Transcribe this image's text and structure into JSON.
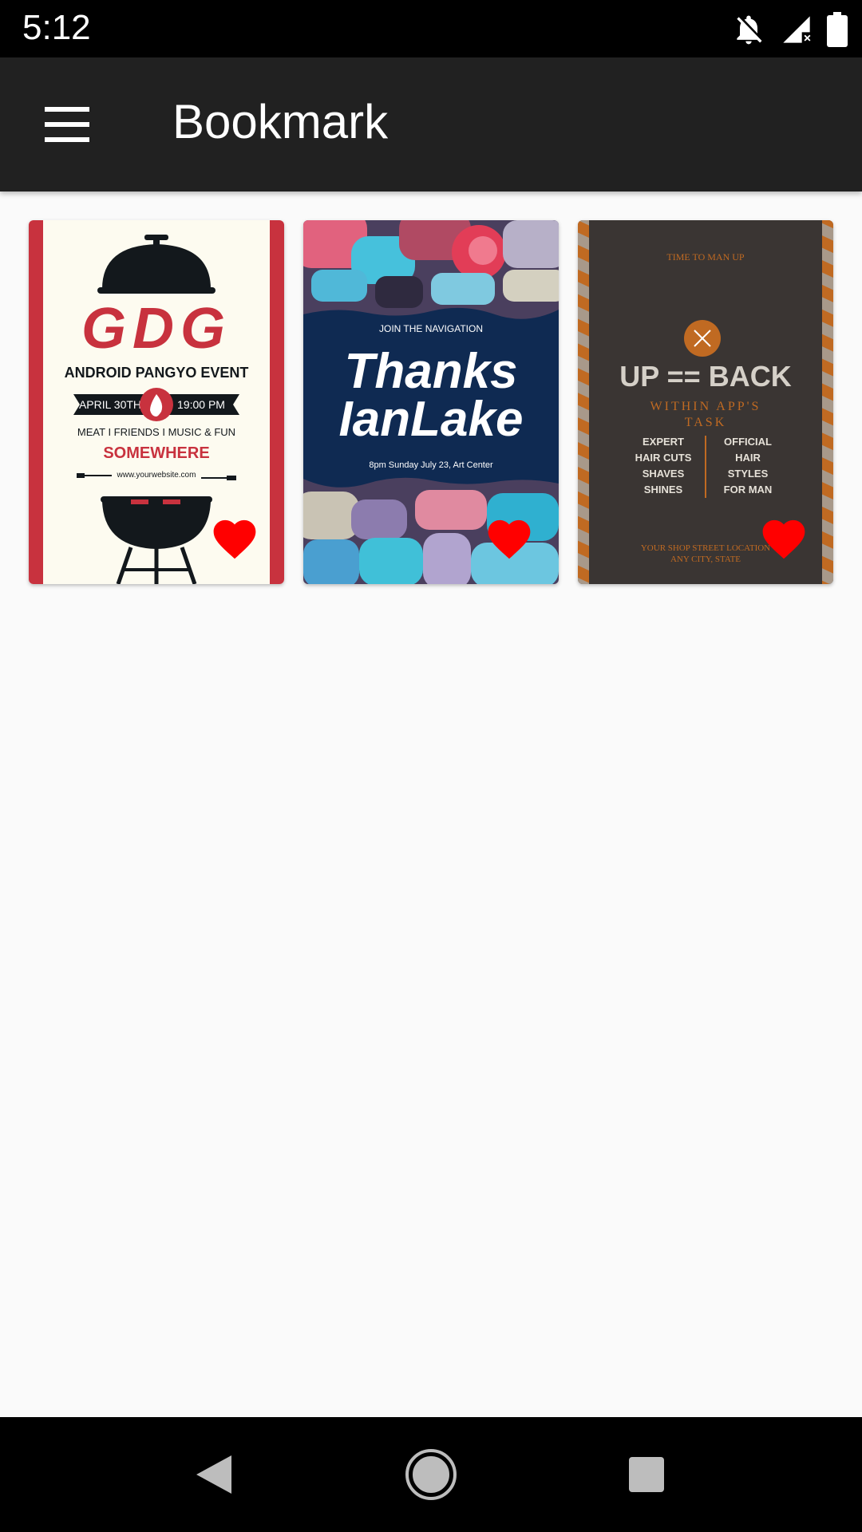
{
  "status_bar": {
    "time": "5:12",
    "icons": [
      "notifications-off-icon",
      "signal-no-data-icon",
      "battery-full-icon"
    ]
  },
  "app_bar": {
    "title": "Bookmark",
    "menu_icon": "hamburger-menu-icon"
  },
  "cards": [
    {
      "theme_color": "#c8323e",
      "lines": {
        "title": "GDG",
        "event": "ANDROID PANGYO EVENT",
        "date": "APRIL 30TH",
        "time": "19:00 PM",
        "tags": "MEAT  I  FRIENDS  I  MUSIC & FUN",
        "place": "SOMEWHERE",
        "url": "www.yourwebsite.com"
      },
      "bookmarked": true
    },
    {
      "theme_color": "#0f2a52",
      "lines": {
        "kicker": "JOIN THE NAVIGATION",
        "title1": "Thanks",
        "title2": "IanLake",
        "sub": "8pm Sunday July 23, Art Center"
      },
      "bookmarked": true
    },
    {
      "theme_color": "#3a3533",
      "lines": {
        "kicker": "TIME TO MAN UP",
        "title": "UP == BACK",
        "sub1": "WITHIN APP'S",
        "sub2": "TASK",
        "left1": "EXPERT",
        "left2": "HAIR CUTS",
        "left3": "SHAVES",
        "left4": "SHINES",
        "right1": "OFFICIAL",
        "right2": "HAIR",
        "right3": "STYLES",
        "right4": "FOR MAN",
        "addr1": "YOUR SHOP STREET LOCATION",
        "addr2": "ANY CITY, STATE"
      },
      "bookmarked": true
    }
  ],
  "nav_bar": {
    "back_icon": "back-triangle-icon",
    "home_icon": "home-circle-icon",
    "recents_icon": "recents-square-icon"
  },
  "colors": {
    "heart": "#ff0000",
    "app_bar": "#212121",
    "background": "#fafafa"
  }
}
